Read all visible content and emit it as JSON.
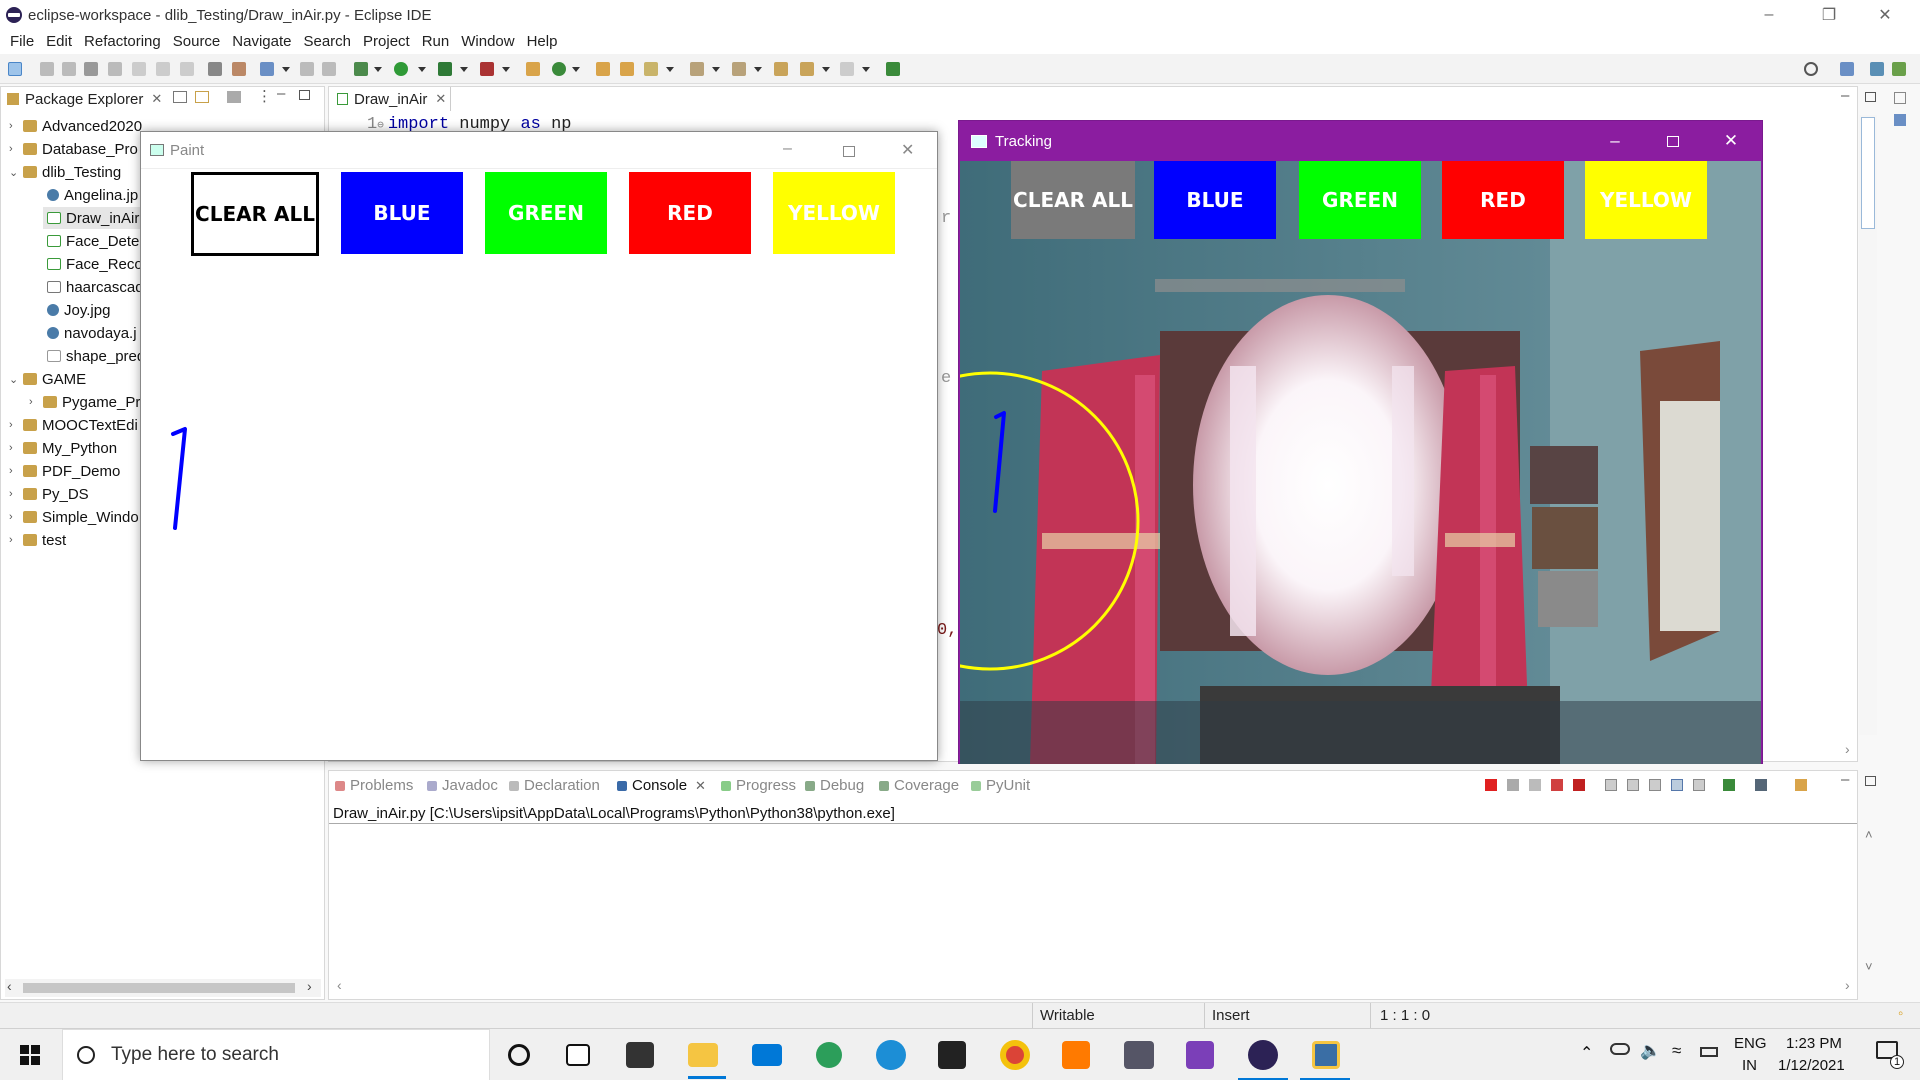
{
  "window": {
    "title": "eclipse-workspace - dlib_Testing/Draw_inAir.py - Eclipse IDE"
  },
  "menu": [
    "File",
    "Edit",
    "Refactoring",
    "Source",
    "Navigate",
    "Search",
    "Project",
    "Run",
    "Window",
    "Help"
  ],
  "package_explorer": {
    "title": "Package Explorer",
    "items": [
      {
        "label": "Advanced2020",
        "type": "project",
        "expanded": false
      },
      {
        "label": "Database_Pro",
        "type": "project",
        "expanded": false
      },
      {
        "label": "dlib_Testing",
        "type": "project",
        "expanded": true
      },
      {
        "label": "Angelina.jp",
        "type": "image"
      },
      {
        "label": "Draw_inAir",
        "type": "python",
        "selected": true
      },
      {
        "label": "Face_Detec",
        "type": "python"
      },
      {
        "label": "Face_Recog",
        "type": "python"
      },
      {
        "label": "haarcascad",
        "type": "xml"
      },
      {
        "label": "Joy.jpg",
        "type": "image"
      },
      {
        "label": "navodaya.j",
        "type": "image"
      },
      {
        "label": "shape_pred",
        "type": "file"
      },
      {
        "label": "GAME",
        "type": "project",
        "expanded": true
      },
      {
        "label": "Pygame_Pr",
        "type": "folder"
      },
      {
        "label": "MOOCTextEdi",
        "type": "project"
      },
      {
        "label": "My_Python",
        "type": "project"
      },
      {
        "label": "PDF_Demo",
        "type": "project"
      },
      {
        "label": "Py_DS",
        "type": "project"
      },
      {
        "label": "Simple_Windo",
        "type": "project"
      },
      {
        "label": "test",
        "type": "project"
      }
    ]
  },
  "editor": {
    "tab": "Draw_inAir",
    "line_number": "1",
    "code": {
      "kw1": "import",
      "mid": " numpy ",
      "kw2": "as",
      "tail": " np"
    },
    "fragments": {
      "r": "r",
      "e": "e",
      "zero": "0,"
    }
  },
  "console": {
    "tabs": [
      "Problems",
      "Javadoc",
      "Declaration",
      "Console",
      "Progress",
      "Debug",
      "Coverage",
      "PyUnit"
    ],
    "active_tab": "Console",
    "path": "Draw_inAir.py [C:\\Users\\ipsit\\AppData\\Local\\Programs\\Python\\Python38\\python.exe]"
  },
  "status": {
    "writable": "Writable",
    "insert": "Insert",
    "position": "1 : 1 : 0"
  },
  "paint_window": {
    "title": "Paint",
    "buttons": [
      {
        "label": "CLEAR ALL",
        "color": "#ffffff",
        "text_color": "#000000"
      },
      {
        "label": "BLUE",
        "color": "#0000ff",
        "text_color": "#ffffff"
      },
      {
        "label": "GREEN",
        "color": "#00ff00",
        "text_color": "#ffffff"
      },
      {
        "label": "RED",
        "color": "#ff0000",
        "text_color": "#ffffff"
      },
      {
        "label": "YELLOW",
        "color": "#ffff00",
        "text_color": "#ffffff"
      }
    ],
    "stroke_color": "#0000ff"
  },
  "tracking_window": {
    "title": "Tracking",
    "buttons": [
      {
        "label": "CLEAR ALL",
        "color": "#7a7a7a"
      },
      {
        "label": "BLUE",
        "color": "#0000ff"
      },
      {
        "label": "GREEN",
        "color": "#00ff00"
      },
      {
        "label": "RED",
        "color": "#ff0000"
      },
      {
        "label": "YELLOW",
        "color": "#ffff00"
      }
    ],
    "tracking_circle_color": "#ffff00",
    "title_bar_color": "#8b1da0"
  },
  "taskbar": {
    "search_placeholder": "Type here to search",
    "apps": [
      "cortana",
      "task-view",
      "store",
      "file-explorer",
      "mail",
      "maps",
      "edge",
      "sticky-notes",
      "chrome",
      "sublime-text",
      "game",
      "visual-studio",
      "eclipse",
      "python-idle"
    ],
    "lang_top": "ENG",
    "lang_bottom": "IN",
    "time": "1:23 PM",
    "date": "1/12/2021",
    "notification_count": "1"
  }
}
